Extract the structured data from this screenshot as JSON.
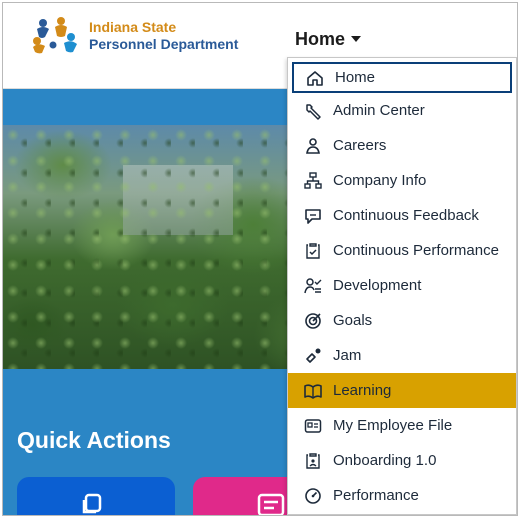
{
  "header": {
    "org_line1": "Indiana State",
    "org_line2": "Personnel Department",
    "nav_label": "Home"
  },
  "quick_actions": {
    "title": "Quick Actions"
  },
  "menu": {
    "items": [
      {
        "label": "Home",
        "icon": "home-icon"
      },
      {
        "label": "Admin Center",
        "icon": "wrench-icon"
      },
      {
        "label": "Careers",
        "icon": "people-icon"
      },
      {
        "label": "Company Info",
        "icon": "org-chart-icon"
      },
      {
        "label": "Continuous Feedback",
        "icon": "feedback-icon"
      },
      {
        "label": "Continuous Performance",
        "icon": "clipboard-check-icon"
      },
      {
        "label": "Development",
        "icon": "person-list-icon"
      },
      {
        "label": "Goals",
        "icon": "target-icon"
      },
      {
        "label": "Jam",
        "icon": "jam-icon"
      },
      {
        "label": "Learning",
        "icon": "book-icon"
      },
      {
        "label": "My Employee File",
        "icon": "id-card-icon"
      },
      {
        "label": "Onboarding 1.0",
        "icon": "clipboard-icon"
      },
      {
        "label": "Performance",
        "icon": "gauge-icon"
      }
    ],
    "focused_item": "Home",
    "selected_item": "Learning"
  },
  "colors": {
    "band_blue": "#2b86c5",
    "menu_highlight": "#d8a100",
    "org_orange": "#d38b19",
    "org_blue": "#2a5a98",
    "tile_blue": "#0b5fd2",
    "tile_pink": "#e0298a"
  }
}
